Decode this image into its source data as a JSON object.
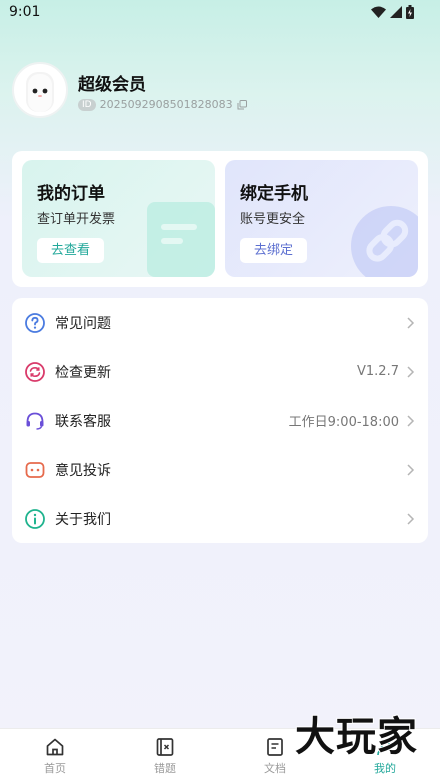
{
  "status": {
    "time": "9:01"
  },
  "profile": {
    "name": "超级会员",
    "id_label": "ID",
    "id_value": "2025092908501828083"
  },
  "cards": {
    "orders": {
      "title": "我的订单",
      "subtitle": "查订单开发票",
      "button": "去查看"
    },
    "bind": {
      "title": "绑定手机",
      "subtitle": "账号更安全",
      "button": "去绑定"
    }
  },
  "menu": {
    "items": [
      {
        "label": "常见问题",
        "value": ""
      },
      {
        "label": "检查更新",
        "value": "V1.2.7"
      },
      {
        "label": "联系客服",
        "value": "工作日9:00-18:00"
      },
      {
        "label": "意见投诉",
        "value": ""
      },
      {
        "label": "关于我们",
        "value": ""
      }
    ]
  },
  "tabbar": {
    "tabs": [
      {
        "label": "首页"
      },
      {
        "label": "错题"
      },
      {
        "label": "文档"
      },
      {
        "label": "我的"
      }
    ]
  },
  "watermark": "大玩家",
  "colors": {
    "accent": "#22a89a",
    "bind_accent": "#5c6fd0"
  }
}
